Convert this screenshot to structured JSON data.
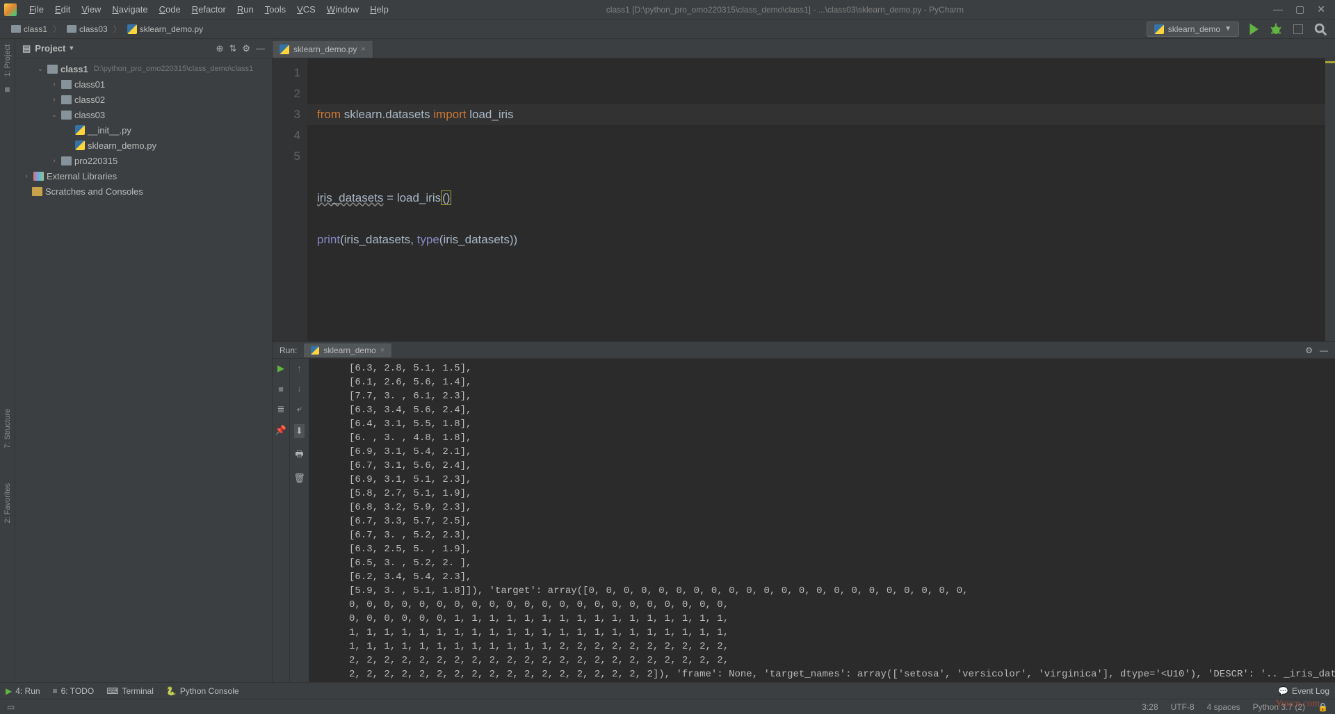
{
  "menubar": {
    "items": [
      "File",
      "Edit",
      "View",
      "Navigate",
      "Code",
      "Refactor",
      "Run",
      "Tools",
      "VCS",
      "Window",
      "Help"
    ],
    "title": "class1 [D:\\python_pro_omo220315\\class_demo\\class1] - ...\\class03\\sklearn_demo.py - PyCharm"
  },
  "breadcrumb": {
    "parts": [
      "class1",
      "class03",
      "sklearn_demo.py"
    ],
    "run_config": "sklearn_demo"
  },
  "project": {
    "header": "Project",
    "root": {
      "name": "class1",
      "path": "D:\\python_pro_omo220315\\class_demo\\class1"
    },
    "children": [
      {
        "name": "class01",
        "type": "dir",
        "depth": 2,
        "arrow": "›"
      },
      {
        "name": "class02",
        "type": "dir",
        "depth": 2,
        "arrow": "›"
      },
      {
        "name": "class03",
        "type": "dir",
        "depth": 2,
        "arrow": "⌄",
        "expanded": true
      },
      {
        "name": "__init__.py",
        "type": "py",
        "depth": 3,
        "arrow": ""
      },
      {
        "name": "sklearn_demo.py",
        "type": "py",
        "depth": 3,
        "arrow": ""
      },
      {
        "name": "pro220315",
        "type": "dir",
        "depth": 2,
        "arrow": "›"
      }
    ],
    "external": "External Libraries",
    "scratches": "Scratches and Consoles"
  },
  "editor": {
    "tab": "sklearn_demo.py",
    "lines": [
      "1",
      "2",
      "3",
      "4",
      "5"
    ],
    "code": {
      "l1_from": "from ",
      "l1_mod": "sklearn.datasets ",
      "l1_import": "import ",
      "l1_name": "load_iris",
      "l3_var": "iris_datasets",
      "l3_eq": " = ",
      "l3_fn": "load_iris",
      "l3_par": "()",
      "l4_print": "print",
      "l4_open": "(",
      "l4_arg1": "iris_datasets",
      "l4_comma": ", ",
      "l4_type": "type",
      "l4_open2": "(",
      "l4_arg2": "iris_datasets",
      "l4_close": "))"
    }
  },
  "run": {
    "label": "Run:",
    "tab": "sklearn_demo",
    "output": [
      "[6.3, 2.8, 5.1, 1.5],",
      "[6.1, 2.6, 5.6, 1.4],",
      "[7.7, 3. , 6.1, 2.3],",
      "[6.3, 3.4, 5.6, 2.4],",
      "[6.4, 3.1, 5.5, 1.8],",
      "[6. , 3. , 4.8, 1.8],",
      "[6.9, 3.1, 5.4, 2.1],",
      "[6.7, 3.1, 5.6, 2.4],",
      "[6.9, 3.1, 5.1, 2.3],",
      "[5.8, 2.7, 5.1, 1.9],",
      "[6.8, 3.2, 5.9, 2.3],",
      "[6.7, 3.3, 5.7, 2.5],",
      "[6.7, 3. , 5.2, 2.3],",
      "[6.3, 2.5, 5. , 1.9],",
      "[6.5, 3. , 5.2, 2. ],",
      "[6.2, 3.4, 5.4, 2.3],",
      "[5.9, 3. , 5.1, 1.8]]), 'target': array([0, 0, 0, 0, 0, 0, 0, 0, 0, 0, 0, 0, 0, 0, 0, 0, 0, 0, 0, 0, 0, 0,",
      "0, 0, 0, 0, 0, 0, 0, 0, 0, 0, 0, 0, 0, 0, 0, 0, 0, 0, 0, 0, 0, 0,",
      "0, 0, 0, 0, 0, 0, 1, 1, 1, 1, 1, 1, 1, 1, 1, 1, 1, 1, 1, 1, 1, 1,",
      "1, 1, 1, 1, 1, 1, 1, 1, 1, 1, 1, 1, 1, 1, 1, 1, 1, 1, 1, 1, 1, 1,",
      "1, 1, 1, 1, 1, 1, 1, 1, 1, 1, 1, 1, 2, 2, 2, 2, 2, 2, 2, 2, 2, 2,",
      "2, 2, 2, 2, 2, 2, 2, 2, 2, 2, 2, 2, 2, 2, 2, 2, 2, 2, 2, 2, 2, 2,",
      "2, 2, 2, 2, 2, 2, 2, 2, 2, 2, 2, 2, 2, 2, 2, 2, 2, 2]), 'frame': None, 'target_names': array(['setosa', 'versicolor', 'virginica'], dtype='<U10'), 'DESCR': '.. _iris_dataset:\\n\\nIris plants data"
    ]
  },
  "sidebar_left": {
    "project_tab": "1: Project",
    "structure_tab": "7: Structure",
    "favorites_tab": "2: Favorites"
  },
  "bottom_tabs": {
    "run": "4: Run",
    "todo": "6: TODO",
    "terminal": "Terminal",
    "pyconsole": "Python Console",
    "eventlog": "Event Log"
  },
  "status": {
    "pos": "3:28",
    "encoding": "UTF-8",
    "indent": "4 spaces",
    "python": "Python 3.7 (2)"
  },
  "watermark": "Yuucn.com"
}
